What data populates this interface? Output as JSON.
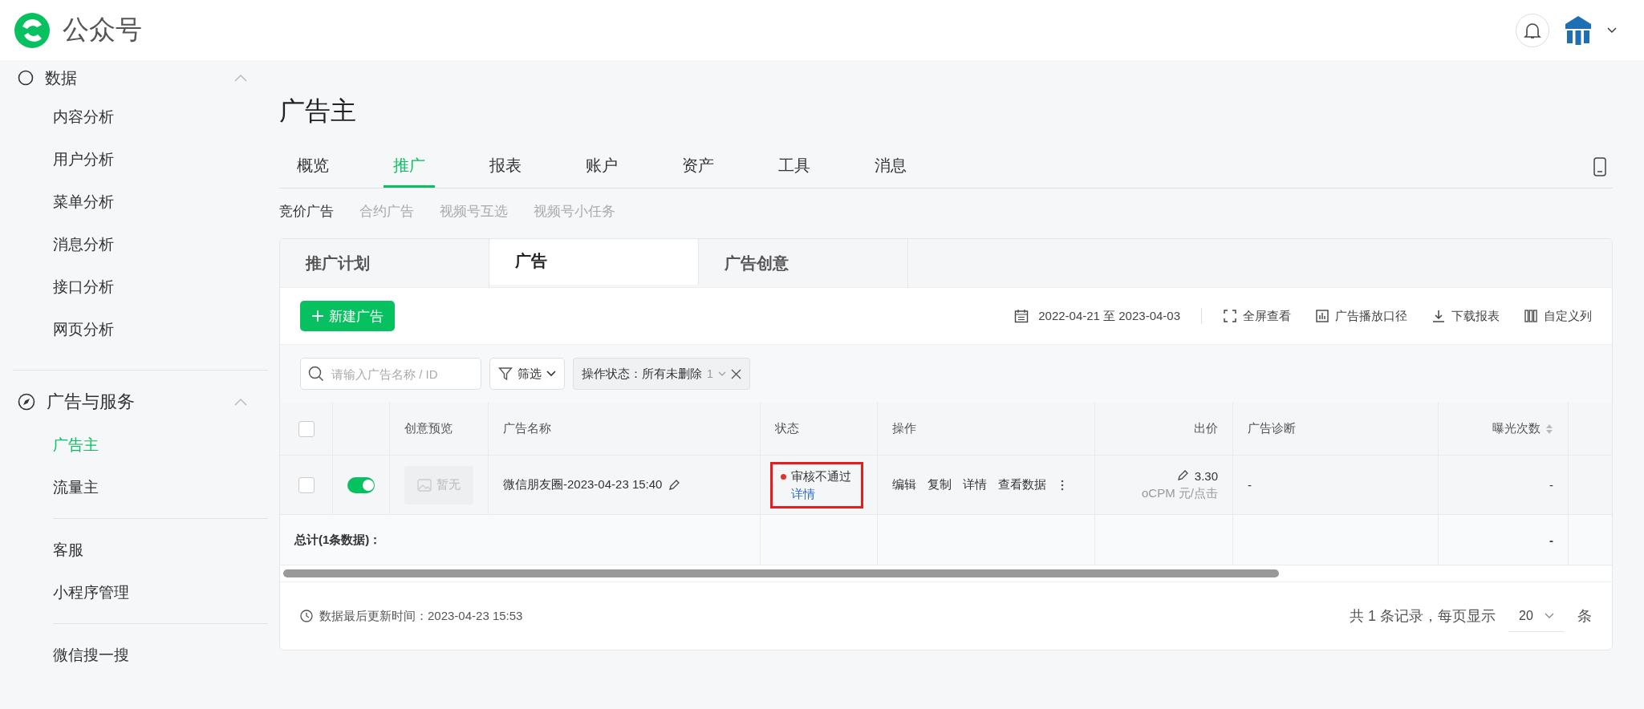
{
  "app": {
    "name": "公众号"
  },
  "sidebar": {
    "groups": [
      {
        "title": "数据",
        "expanded": true,
        "items": [
          {
            "label": "内容分析",
            "selected": false
          },
          {
            "label": "用户分析",
            "selected": false
          },
          {
            "label": "菜单分析",
            "selected": false
          },
          {
            "label": "消息分析",
            "selected": false
          },
          {
            "label": "接口分析",
            "selected": false
          },
          {
            "label": "网页分析",
            "selected": false
          }
        ]
      },
      {
        "title": "广告与服务",
        "expanded": true,
        "items": [
          {
            "label": "广告主",
            "selected": true
          },
          {
            "label": "流量主",
            "selected": false
          }
        ]
      },
      {
        "items": [
          {
            "label": "客服",
            "selected": false
          },
          {
            "label": "小程序管理",
            "selected": false
          }
        ]
      },
      {
        "items": [
          {
            "label": "微信搜一搜",
            "selected": false
          }
        ]
      }
    ]
  },
  "page": {
    "title": "广告主",
    "tabs": [
      {
        "label": "概览",
        "selected": false
      },
      {
        "label": "推广",
        "selected": true
      },
      {
        "label": "报表",
        "selected": false
      },
      {
        "label": "账户",
        "selected": false
      },
      {
        "label": "资产",
        "selected": false
      },
      {
        "label": "工具",
        "selected": false
      },
      {
        "label": "消息",
        "selected": false
      }
    ],
    "subtabs": [
      {
        "label": "竞价广告",
        "selected": true
      },
      {
        "label": "合约广告",
        "selected": false
      },
      {
        "label": "视频号互选",
        "selected": false
      },
      {
        "label": "视频号小任务",
        "selected": false
      }
    ]
  },
  "card": {
    "tabs": [
      {
        "label": "推广计划",
        "selected": false
      },
      {
        "label": "广告",
        "selected": true
      },
      {
        "label": "广告创意",
        "selected": false
      }
    ],
    "toolbar": {
      "new_button": "新建广告",
      "date_range": "2022-04-21 至 2023-04-03",
      "actions": [
        {
          "kind": "fullscreen",
          "label": "全屏查看"
        },
        {
          "kind": "chart",
          "label": "广告播放口径"
        },
        {
          "kind": "download",
          "label": "下载报表"
        },
        {
          "kind": "columns",
          "label": "自定义列"
        }
      ]
    },
    "filters": {
      "search": {
        "placeholder": "请输入广告名称 / ID"
      },
      "filter_button": "筛选",
      "chip": {
        "label": "操作状态：所有未删除",
        "count": "1"
      }
    },
    "table": {
      "select_all": {
        "checked": false
      },
      "columns": [
        {
          "label": "创意预览",
          "sortable": false
        },
        {
          "label": "广告名称",
          "sortable": false
        },
        {
          "label": "状态",
          "sortable": false
        },
        {
          "label": "操作",
          "sortable": false
        },
        {
          "label": "出价",
          "sortable": false
        },
        {
          "label": "广告诊断",
          "sortable": false
        },
        {
          "label": "曝光次数",
          "sortable": true
        }
      ],
      "rows": [
        {
          "checked": false,
          "on": true,
          "preview": "暂无",
          "name": "微信朋友圈-2023-04-23 15:40",
          "status": {
            "label": "审核不通过",
            "color": "#e5322d",
            "link": "详情",
            "highlighted": true
          },
          "actions": [
            "编辑",
            "复制",
            "详情",
            "查看数据"
          ],
          "bid": "3.30",
          "bid_unit": "oCPM 元/点击",
          "diagnosis": "-",
          "impressions": "-"
        }
      ],
      "total": {
        "label": "总计(1条数据)：",
        "impressions": "-"
      }
    },
    "footer": {
      "updated": "数据最后更新时间：2023-04-23 15:53",
      "summary": "共 1 条记录，每页显示",
      "page_size": "20",
      "unit": "条"
    }
  }
}
